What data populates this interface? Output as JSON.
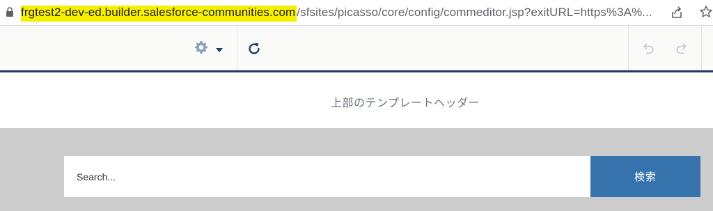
{
  "browser": {
    "url_host": "frgtest2-dev-ed.builder.salesforce-communities.com",
    "url_path": "/sfsites/picasso/core/config/commeditor.jsp?exitURL=https%3A%..."
  },
  "toolbar": {
    "settings_icon": "gear-icon",
    "refresh_icon": "refresh-icon",
    "undo_icon": "undo-icon",
    "redo_icon": "redo-icon"
  },
  "template_header": {
    "text": "上部のテンプレートヘッダー"
  },
  "search": {
    "placeholder": "Search...",
    "button_label": "検索"
  },
  "colors": {
    "highlight": "#f5ef00",
    "toolbar_accent": "#1f3a63",
    "search_button": "#3673ad",
    "gray_area": "#cccccc"
  }
}
